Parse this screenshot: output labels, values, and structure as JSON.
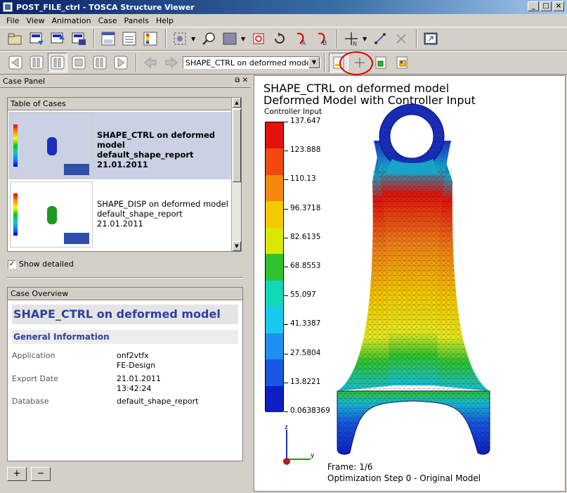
{
  "window": {
    "title": "POST_FILE_ctrl - TOSCA Structure Viewer",
    "controls": [
      "_",
      "□",
      "×"
    ]
  },
  "menu": [
    "File",
    "View",
    "Animation",
    "Case",
    "Panels",
    "Help"
  ],
  "toolbar2": {
    "case_select": "SHAPE_CTRL on deformed model"
  },
  "left_panel": {
    "title": "Case Panel",
    "table_title": "Table of Cases",
    "cases": [
      {
        "name": "SHAPE_CTRL on deformed model",
        "report": "default_shape_report",
        "date": "21.01.2011",
        "selected": true,
        "color": "#1a2ec0"
      },
      {
        "name": "SHAPE_DISP on deformed model",
        "report": "default_shape_report",
        "date": "21.01.2011",
        "selected": false,
        "color": "#1f9a1f"
      }
    ],
    "show_detailed_label": "Show detailed",
    "show_detailed_checked": true,
    "overview": {
      "group_title": "Case Overview",
      "heading": "SHAPE_CTRL on deformed model",
      "section": "General Information",
      "application_label": "Application",
      "application_value_1": "onf2vtfx",
      "application_value_2": "FE-Design",
      "export_label": "Export Date",
      "export_value_1": "21.01.2011",
      "export_value_2": "13:42:24",
      "database_label": "Database",
      "database_value": "default_shape_report"
    },
    "add_label": "+",
    "remove_label": "−"
  },
  "viewer": {
    "title_line1": "SHAPE_CTRL on deformed model",
    "title_line2": "Deformed Model with Controller Input",
    "legend_title": "Controller Input",
    "legend_ticks": [
      "137.647",
      "123.888",
      "110.13",
      "96.3718",
      "82.6135",
      "68.8553",
      "55.097",
      "41.3387",
      "27.5804",
      "13.8221",
      "0.0638369"
    ],
    "legend_colors": [
      "#e3120d",
      "#f04810",
      "#f5880c",
      "#f5c800",
      "#d9e800",
      "#2fc42f",
      "#10d8b8",
      "#18c8f0",
      "#1f90f0",
      "#1758e0",
      "#0d1ec4"
    ],
    "axes": {
      "z": "z",
      "y": "y"
    },
    "frame_text": "Frame: 1/6",
    "step_text": "Optimization Step  0 - Original Model"
  }
}
